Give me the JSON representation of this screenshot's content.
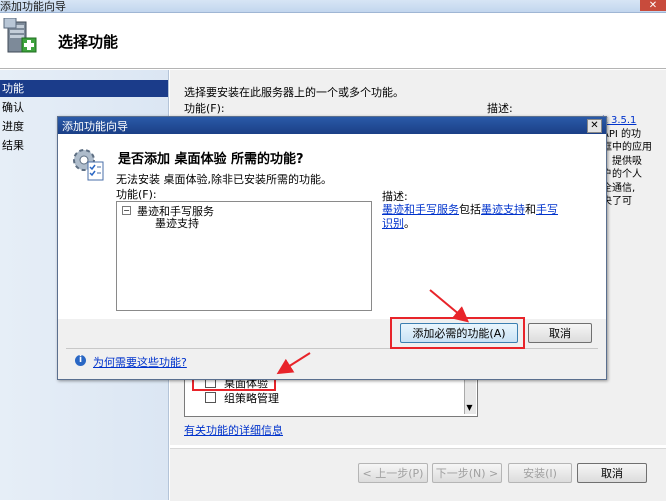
{
  "window": {
    "title": "添加功能向导",
    "close_glyph": "✕"
  },
  "header": {
    "title": "选择功能",
    "icon": "server-add-icon"
  },
  "nav": {
    "items": [
      {
        "label": "功能",
        "active": true
      },
      {
        "label": "确认",
        "active": false
      },
      {
        "label": "进度",
        "active": false
      },
      {
        "label": "结果",
        "active": false
      }
    ]
  },
  "content": {
    "instruction": "选择要安装在此服务器上的一个或多个功能。",
    "features_label": "功能(F):",
    "description_label": "描述:",
    "visible_features": [
      {
        "label": "桌面体验",
        "checked": false
      },
      {
        "label": "组策略管理",
        "checked": false
      }
    ],
    "more_info_link": "有关功能的详细信息",
    "desc_partial": {
      "line1": "k 3.5.1",
      "line2": "API 的功",
      "line3": "框中的应用",
      "line4": "。提供吸",
      "line5": "户的个人",
      "line6": "全通信,",
      "line7": "央了可"
    }
  },
  "buttons": {
    "prev": "< 上一步(P)",
    "next": "下一步(N) >",
    "install": "安装(I)",
    "cancel": "取消"
  },
  "dialog": {
    "title": "添加功能向导",
    "close_glyph": "✕",
    "question": "是否添加 桌面体验 所需的功能?",
    "explanation": "无法安装 桌面体验,除非已安装所需的功能。",
    "features_label": "功能(F):",
    "tree": {
      "expander": "−",
      "parent": "墨迹和手写服务",
      "child": "墨迹支持"
    },
    "description_label": "描述:",
    "description": {
      "link1": "墨迹和手写服务",
      "text1": "包括",
      "link2": "墨迹支持",
      "text2": "和",
      "link3": "手写识别",
      "text3": "。"
    },
    "add_button": "添加必需的功能(A)",
    "cancel_button": "取消",
    "help_icon_glyph": "i",
    "help_link": "为何需要这些功能?"
  },
  "colors": {
    "nav_active": "#1b3c8a",
    "link": "#0033cc",
    "highlight_box": "#e8242a",
    "dialog_title": "#1b3f86"
  }
}
